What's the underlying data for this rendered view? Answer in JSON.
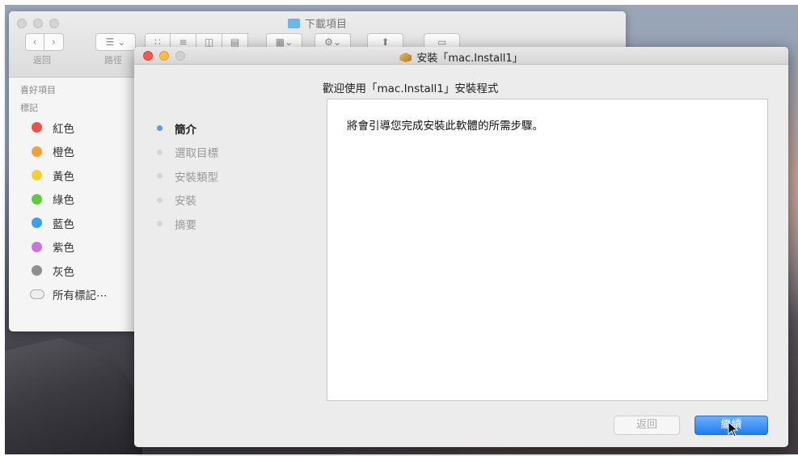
{
  "finder": {
    "title": "下載項目",
    "back_label": "返回",
    "path_label": "路徑",
    "sidebar": {
      "favorites_heading": "喜好項目",
      "tags_heading": "標記",
      "tags": [
        {
          "label": "紅色",
          "color": "#f2504b"
        },
        {
          "label": "橙色",
          "color": "#f4a032"
        },
        {
          "label": "黃色",
          "color": "#f5cf32"
        },
        {
          "label": "綠色",
          "color": "#5ccb3c"
        },
        {
          "label": "藍色",
          "color": "#3a9ff2"
        },
        {
          "label": "紫色",
          "color": "#c974d9"
        },
        {
          "label": "灰色",
          "color": "#8e8e8e"
        }
      ],
      "all_tags_label": "所有標記⋯"
    }
  },
  "installer": {
    "title": "安裝「mac.Install1」",
    "heading": "歡迎使用「mac.Install1」安裝程式",
    "steps": [
      "簡介",
      "選取目標",
      "安裝類型",
      "安裝",
      "摘要"
    ],
    "active_step": 0,
    "body_text": "將會引導您完成安裝此軟體的所需步驟。",
    "back_button": "返回",
    "continue_button": "繼續"
  }
}
